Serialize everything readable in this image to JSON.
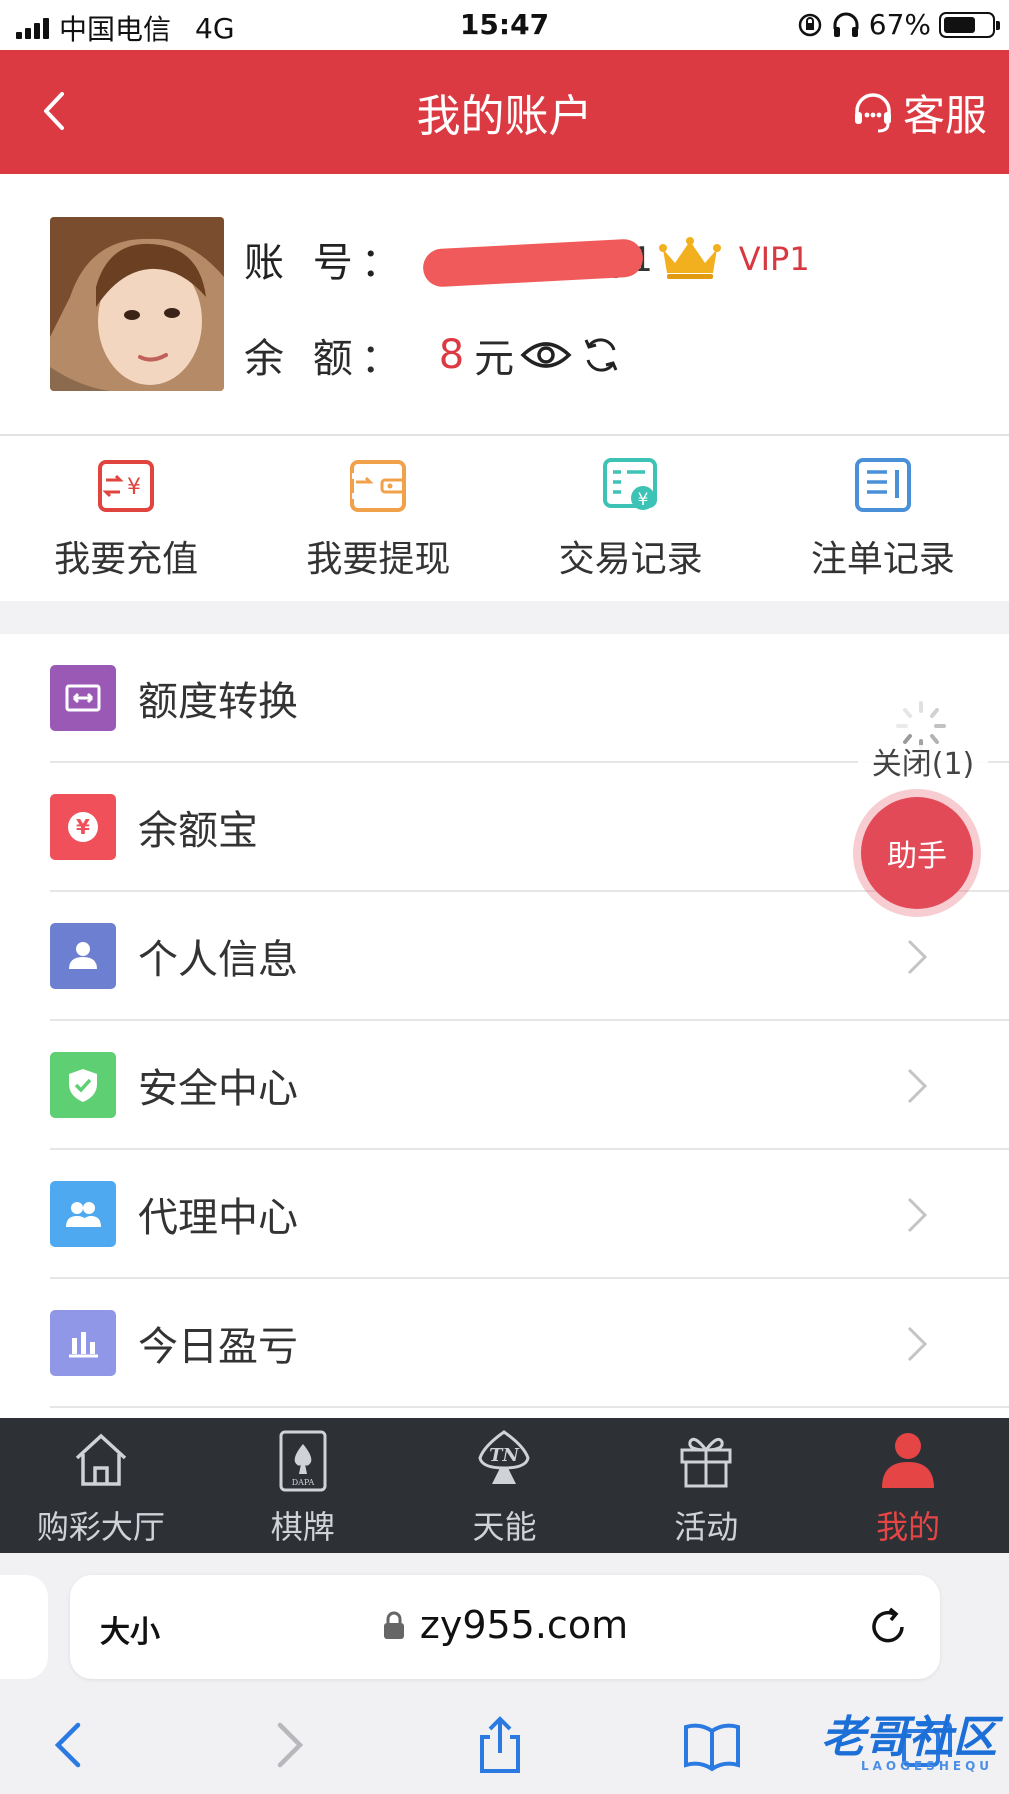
{
  "status_bar": {
    "carrier": "中国电信",
    "network": "4G",
    "time": "15:47",
    "battery_percent": "67%",
    "battery_level": 0.67
  },
  "header": {
    "title": "我的账户",
    "back_icon": "chevron-left-icon",
    "service_label": "客服",
    "service_icon": "headset-icon",
    "color": "#dc3a42"
  },
  "profile": {
    "account_label": "账 号：",
    "account_visible_suffix": "y1",
    "vip_label": "VIP1",
    "balance_label": "余 额：",
    "balance_value": "8",
    "balance_unit": "元"
  },
  "quick_actions": [
    {
      "label": "我要充值",
      "icon": "recharge-icon",
      "color": "#e0443f"
    },
    {
      "label": "我要提现",
      "icon": "wallet-withdraw-icon",
      "color": "#f0a14a"
    },
    {
      "label": "交易记录",
      "icon": "transaction-record-icon",
      "color": "#3cc3b5"
    },
    {
      "label": "注单记录",
      "icon": "bet-record-icon",
      "color": "#4a90d9"
    }
  ],
  "menu": [
    {
      "label": "额度转换",
      "icon": "transfer-icon",
      "color": "#9b59b6"
    },
    {
      "label": "余额宝",
      "icon": "yuan-icon",
      "color": "#f0505a"
    },
    {
      "label": "个人信息",
      "icon": "user-icon",
      "color": "#6c7fd0"
    },
    {
      "label": "安全中心",
      "icon": "shield-icon",
      "color": "#5fcf74"
    },
    {
      "label": "代理中心",
      "icon": "agents-icon",
      "color": "#4ea9f0"
    },
    {
      "label": "今日盈亏",
      "icon": "bar-chart-icon",
      "color": "#8f97e6"
    }
  ],
  "floating": {
    "close_label": "关闭(1)",
    "assistant_label": "助手"
  },
  "tabbar": [
    {
      "label": "购彩大厅",
      "icon": "home-icon"
    },
    {
      "label": "棋牌",
      "icon": "cards-icon"
    },
    {
      "label": "天能",
      "icon": "tn-logo-icon"
    },
    {
      "label": "活动",
      "icon": "gift-icon"
    },
    {
      "label": "我的",
      "icon": "person-icon",
      "active": true
    }
  ],
  "browser": {
    "text_size_label": "大小",
    "url": "zy955.com"
  },
  "watermark": {
    "text": "老哥社区",
    "subtext": "LAOGESHEQU"
  }
}
